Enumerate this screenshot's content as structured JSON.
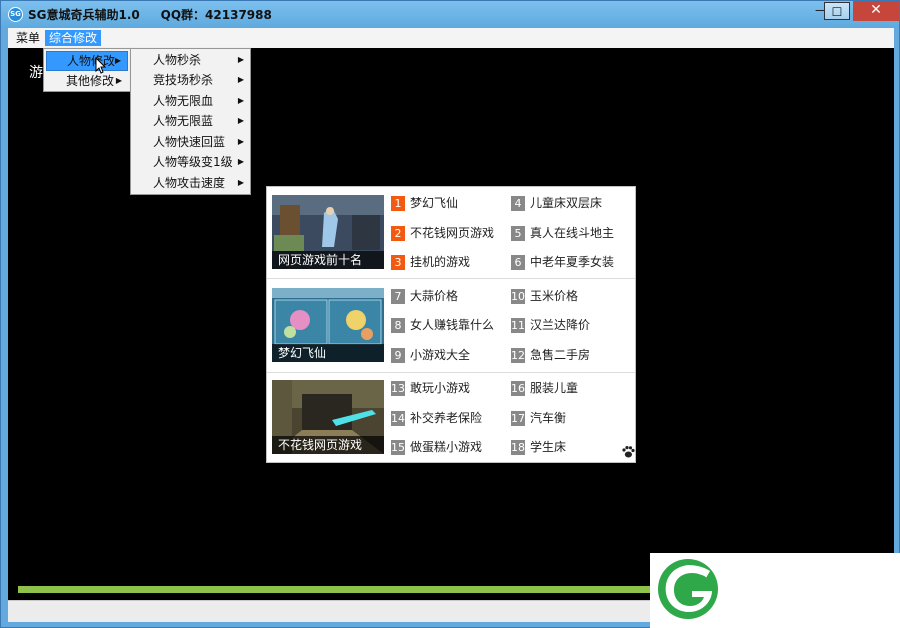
{
  "window": {
    "app_icon_text": "SG",
    "title": "SG意城奇兵辅助1.0     QQ群：42137988",
    "min_label": "—",
    "max_label": "☐",
    "close_label": "✕"
  },
  "menubar": {
    "items": [
      {
        "label": "菜单"
      },
      {
        "label": "综合修改"
      }
    ]
  },
  "content": {
    "text": "游",
    "progress": 0.99,
    "colors": {
      "progress": "#8fc24a",
      "accent": "#3399ff",
      "hot": "#f25a12"
    }
  },
  "menu_level1": [
    {
      "label": "人物修改"
    },
    {
      "label": "其他修改"
    }
  ],
  "menu_level2": [
    {
      "label": "人物秒杀"
    },
    {
      "label": "竞技场秒杀"
    },
    {
      "label": "人物无限血"
    },
    {
      "label": "人物无限蓝"
    },
    {
      "label": "人物快速回蓝"
    },
    {
      "label": "人物等级变1级"
    },
    {
      "label": "人物攻击速度"
    }
  ],
  "ad": {
    "thumbs": [
      {
        "caption": "网页游戏前十名"
      },
      {
        "caption": "梦幻飞仙"
      },
      {
        "caption": "不花钱网页游戏"
      }
    ],
    "links": [
      {
        "num": "1",
        "text": "梦幻飞仙"
      },
      {
        "num": "2",
        "text": "不花钱网页游戏"
      },
      {
        "num": "3",
        "text": "挂机的游戏"
      },
      {
        "num": "4",
        "text": "儿童床双层床"
      },
      {
        "num": "5",
        "text": "真人在线斗地主"
      },
      {
        "num": "6",
        "text": "中老年夏季女装"
      },
      {
        "num": "7",
        "text": "大蒜价格"
      },
      {
        "num": "8",
        "text": "女人赚钱靠什么"
      },
      {
        "num": "9",
        "text": "小游戏大全"
      },
      {
        "num": "10",
        "text": "玉米价格"
      },
      {
        "num": "11",
        "text": "汉兰达降价"
      },
      {
        "num": "12",
        "text": "急售二手房"
      },
      {
        "num": "13",
        "text": "敢玩小游戏"
      },
      {
        "num": "14",
        "text": "补交养老保险"
      },
      {
        "num": "15",
        "text": "做蛋糕小游戏"
      },
      {
        "num": "16",
        "text": "服装儿童"
      },
      {
        "num": "17",
        "text": "汽车衡"
      },
      {
        "num": "18",
        "text": "学生床"
      }
    ]
  }
}
